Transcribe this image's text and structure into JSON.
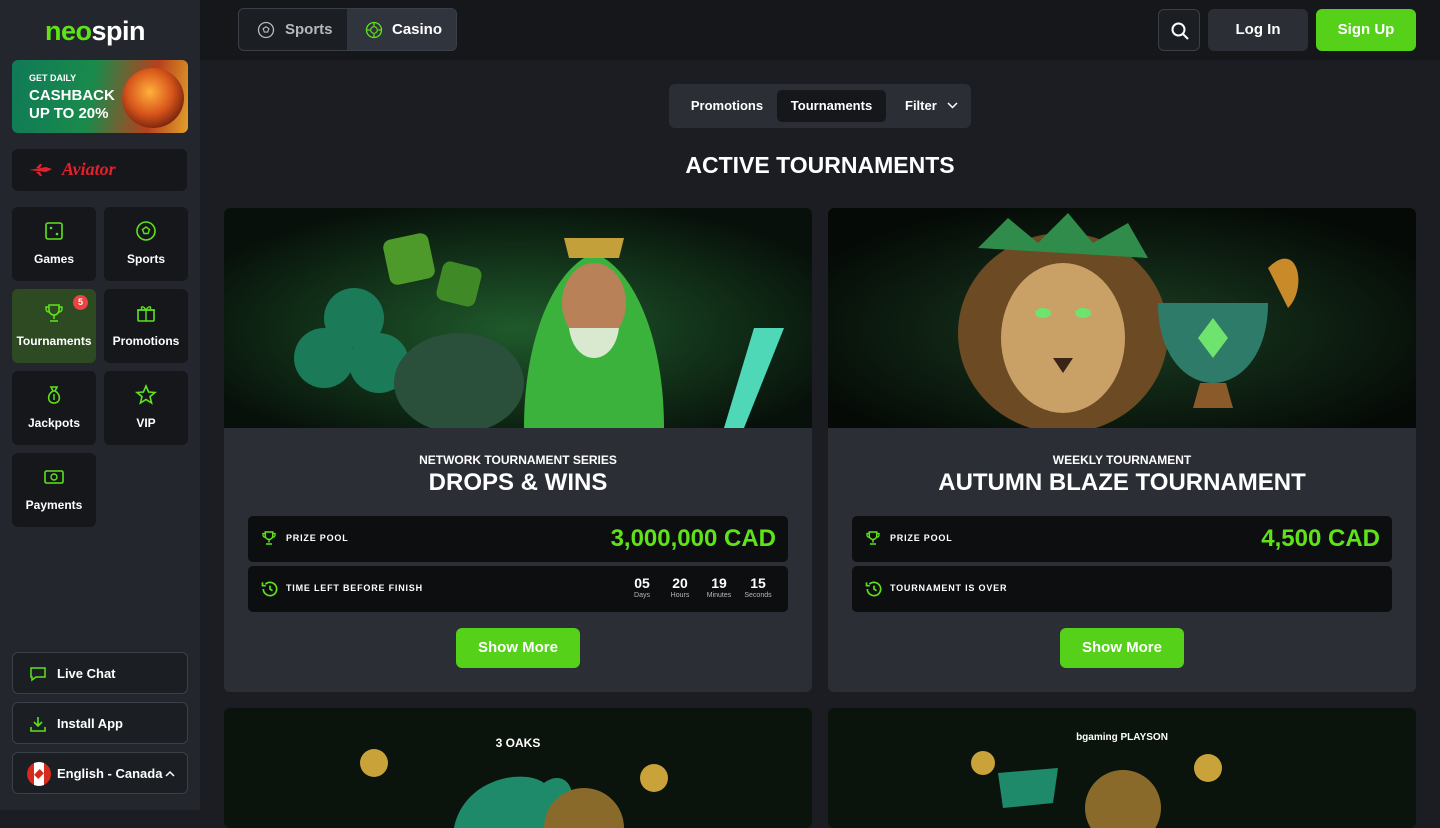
{
  "logo": {
    "part1": "neo",
    "part2": "spin"
  },
  "promo_banner": {
    "line1": "GET DAILY",
    "line2": "CASHBACK",
    "line3": "UP TO 20%"
  },
  "aviator": {
    "label": "Aviator"
  },
  "nav": {
    "games": "Games",
    "sports": "Sports",
    "tournaments": "Tournaments",
    "tournaments_badge": "5",
    "promotions": "Promotions",
    "jackpots": "Jackpots",
    "vip": "VIP",
    "payments": "Payments"
  },
  "sidebar_bottom": {
    "live_chat": "Live Chat",
    "install_app": "Install App",
    "language": "English - Canada"
  },
  "header": {
    "sports": "Sports",
    "casino": "Casino",
    "login": "Log In",
    "signup": "Sign Up"
  },
  "tabs": {
    "promotions": "Promotions",
    "tournaments": "Tournaments",
    "filter": "Filter"
  },
  "section_title": "ACTIVE TOURNAMENTS",
  "cards": [
    {
      "subtitle": "NETWORK TOURNAMENT SERIES",
      "title": "DROPS & WINS",
      "prize_label": "PRIZE POOL",
      "prize": "3,000,000 CAD",
      "status_label": "TIME LEFT BEFORE FINISH",
      "countdown": [
        {
          "value": "05",
          "unit": "Days"
        },
        {
          "value": "20",
          "unit": "Hours"
        },
        {
          "value": "19",
          "unit": "Minutes"
        },
        {
          "value": "15",
          "unit": "Seconds"
        }
      ],
      "button": "Show More",
      "art_badge": "DROPS & WINS"
    },
    {
      "subtitle": "WEEKLY TOURNAMENT",
      "title": "AUTUMN BLAZE TOURNAMENT",
      "prize_label": "PRIZE POOL",
      "prize": "4,500 CAD",
      "status_label": "TOURNAMENT IS OVER",
      "button": "Show More"
    }
  ],
  "lower_cards": [
    {
      "brand": "3 OAKS"
    },
    {
      "brand": "bgaming  PLAYSON"
    }
  ],
  "colors": {
    "accent": "#55d11a",
    "bg": "#1b1d22",
    "panel": "#2b2e35",
    "badge": "#ea4343"
  }
}
